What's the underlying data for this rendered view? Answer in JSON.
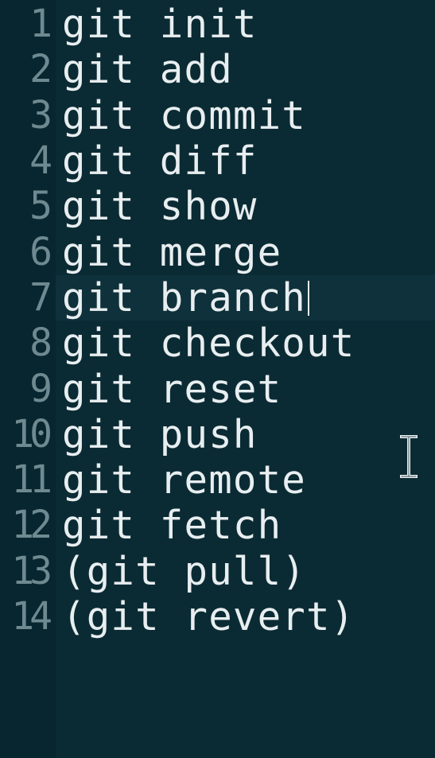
{
  "editor": {
    "lines": [
      {
        "number": "1",
        "text": "git init"
      },
      {
        "number": "2",
        "text": "git add"
      },
      {
        "number": "3",
        "text": "git commit"
      },
      {
        "number": "4",
        "text": "git diff"
      },
      {
        "number": "5",
        "text": "git show"
      },
      {
        "number": "6",
        "text": "git merge"
      },
      {
        "number": "7",
        "text": "git branch"
      },
      {
        "number": "8",
        "text": "git checkout"
      },
      {
        "number": "9",
        "text": "git reset"
      },
      {
        "number": "10",
        "text": "git push"
      },
      {
        "number": "11",
        "text": "git remote"
      },
      {
        "number": "12",
        "text": "git fetch"
      },
      {
        "number": "13",
        "text": "(git pull)"
      },
      {
        "number": "14",
        "text": "(git revert)"
      }
    ],
    "current_line": 7,
    "cursor_icon": "text-cursor-icon",
    "colors": {
      "background": "#0b2b34",
      "gutter": "#072630",
      "current_line": "#0f313b",
      "text": "#e8eef0",
      "line_number": "#6f8990"
    }
  }
}
